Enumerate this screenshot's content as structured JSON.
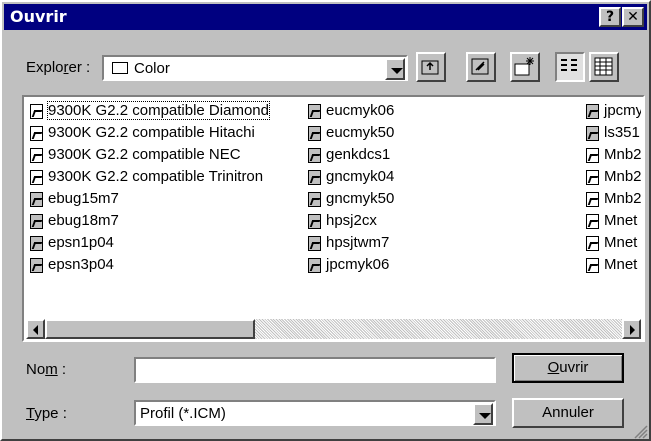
{
  "window": {
    "title": "Ouvrir",
    "help_label": "?",
    "close_label": "✕"
  },
  "lookin": {
    "label_pre": "Explo",
    "label_u": "r",
    "label_post": "er :",
    "value": "Color"
  },
  "toolbar": {
    "up_icon": "up-folder-icon",
    "desktop_icon": "desktop-icon",
    "new_folder_icon": "new-folder-icon",
    "list_view_icon": "list-view-icon",
    "details_view_icon": "details-view-icon"
  },
  "files": {
    "col1": [
      {
        "name": "9300K G2.2 compatible Diamond",
        "icon": "profile-link-icon"
      },
      {
        "name": "9300K G2.2 compatible Hitachi",
        "icon": "profile-link-icon"
      },
      {
        "name": "9300K G2.2 compatible NEC",
        "icon": "profile-link-icon"
      },
      {
        "name": "9300K G2.2 compatible Trinitron",
        "icon": "profile-link-icon"
      },
      {
        "name": "ebug15m7",
        "icon": "profile-icon"
      },
      {
        "name": "ebug18m7",
        "icon": "profile-icon"
      },
      {
        "name": "epsn1p04",
        "icon": "profile-icon"
      },
      {
        "name": "epsn3p04",
        "icon": "profile-icon"
      }
    ],
    "col2": [
      {
        "name": "eucmyk06",
        "icon": "profile-icon"
      },
      {
        "name": "eucmyk50",
        "icon": "profile-icon"
      },
      {
        "name": "genkdcs1",
        "icon": "profile-icon"
      },
      {
        "name": "gncmyk04",
        "icon": "profile-icon"
      },
      {
        "name": "gncmyk50",
        "icon": "profile-icon"
      },
      {
        "name": "hpsj2cx",
        "icon": "profile-icon"
      },
      {
        "name": "hpsjtwm7",
        "icon": "profile-icon"
      },
      {
        "name": "jpcmyk06",
        "icon": "profile-icon"
      }
    ],
    "col3": [
      {
        "name": "jpcmy",
        "icon": "profile-icon"
      },
      {
        "name": "ls351",
        "icon": "profile-icon"
      },
      {
        "name": "Mnb2",
        "icon": "profile-link-icon"
      },
      {
        "name": "Mnb2",
        "icon": "profile-link-icon"
      },
      {
        "name": "Mnb2",
        "icon": "profile-link-icon"
      },
      {
        "name": "Mnet",
        "icon": "profile-link-icon"
      },
      {
        "name": "Mnet",
        "icon": "profile-link-icon"
      },
      {
        "name": "Mnet",
        "icon": "profile-link-icon"
      }
    ]
  },
  "filename": {
    "label_pre": "No",
    "label_u": "m",
    "label_post": " :",
    "value": ""
  },
  "filetype": {
    "label_u": "T",
    "label_post": "ype :",
    "value": "Profil (*.ICM)"
  },
  "buttons": {
    "open_u": "O",
    "open_rest": "uvrir",
    "cancel": "Annuler"
  }
}
